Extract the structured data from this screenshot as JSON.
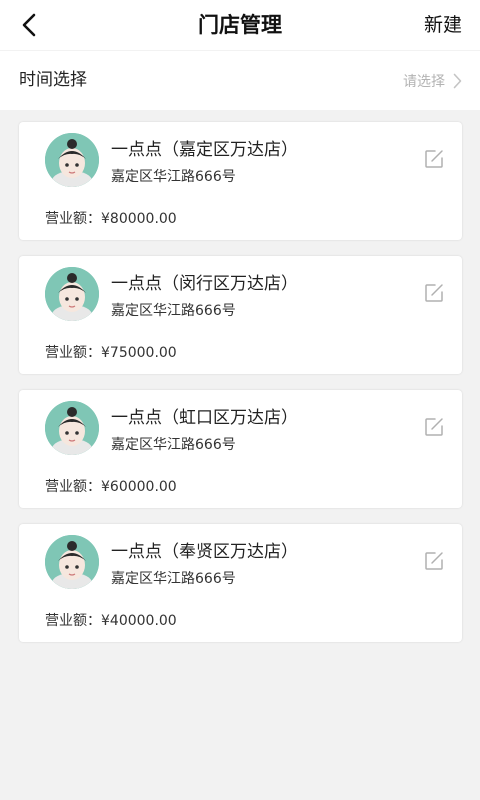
{
  "header": {
    "title": "门店管理",
    "new_label": "新建",
    "back_icon": "chevron-left-icon"
  },
  "filter": {
    "label": "时间选择",
    "placeholder": "请选择",
    "chevron_icon": "chevron-right-icon"
  },
  "stores": [
    {
      "name": "一点点（嘉定区万达店）",
      "address": "嘉定区华江路666号",
      "revenue_label": "营业额：",
      "revenue": "¥80000.00"
    },
    {
      "name": "一点点（闵行区万达店）",
      "address": "嘉定区华江路666号",
      "revenue_label": "营业额：",
      "revenue": "¥75000.00"
    },
    {
      "name": "一点点（虹口区万达店）",
      "address": "嘉定区华江路666号",
      "revenue_label": "营业额：",
      "revenue": "¥60000.00"
    },
    {
      "name": "一点点（奉贤区万达店）",
      "address": "嘉定区华江路666号",
      "revenue_label": "营业额：",
      "revenue": "¥40000.00"
    }
  ],
  "colors": {
    "background": "#f2f2f2",
    "card": "#ffffff",
    "avatar_bg": "#7fc6b5",
    "placeholder": "#b3b3b3"
  }
}
